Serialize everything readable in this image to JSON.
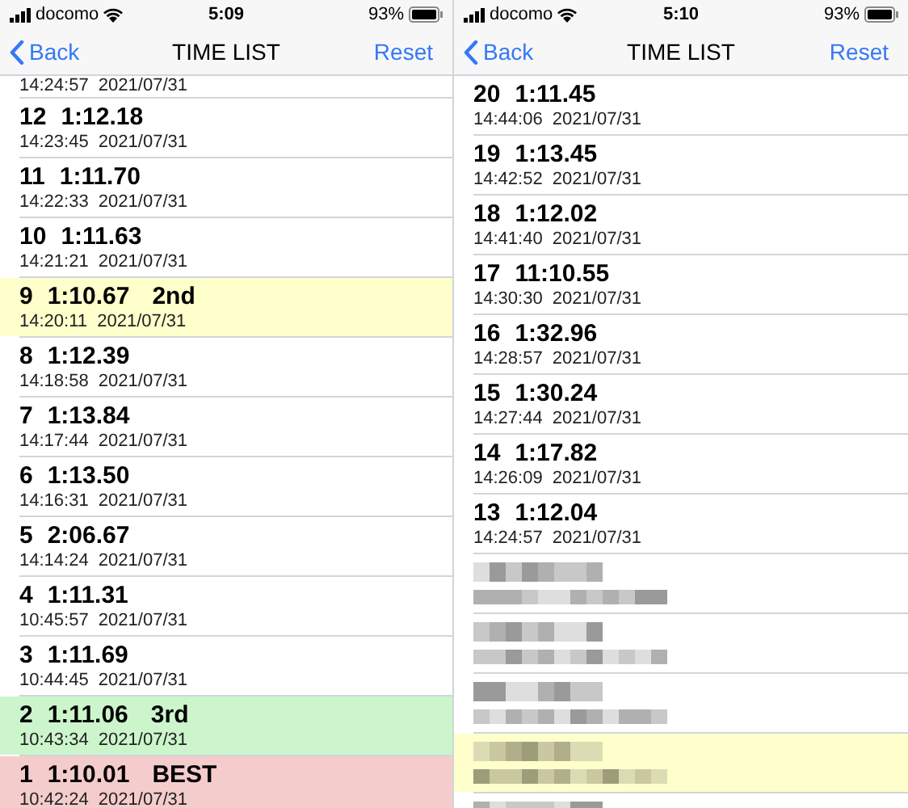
{
  "screens": [
    {
      "status_bar": {
        "carrier": "docomo",
        "time": "5:09",
        "battery": "93%"
      },
      "nav": {
        "back": "Back",
        "title": "TIME LIST",
        "action": "Reset"
      },
      "rows": [
        {
          "kind": "partial",
          "stamp": "14:24:57  2021/07/31",
          "color": "#ffffff"
        },
        {
          "kind": "lap",
          "number": "12",
          "time": "1:12.18",
          "stamp": "14:23:45  2021/07/31",
          "color": "#ffffff"
        },
        {
          "kind": "lap",
          "number": "11",
          "time": "1:11.70",
          "stamp": "14:22:33  2021/07/31",
          "color": "#ffffff"
        },
        {
          "kind": "lap",
          "number": "10",
          "time": "1:11.63",
          "stamp": "14:21:21  2021/07/31",
          "color": "#ffffff"
        },
        {
          "kind": "lap",
          "number": "9",
          "time": "1:10.67",
          "rank": "2nd",
          "stamp": "14:20:11  2021/07/31",
          "color": "#ffffcc"
        },
        {
          "kind": "lap",
          "number": "8",
          "time": "1:12.39",
          "stamp": "14:18:58  2021/07/31",
          "color": "#ffffff"
        },
        {
          "kind": "lap",
          "number": "7",
          "time": "1:13.84",
          "stamp": "14:17:44  2021/07/31",
          "color": "#ffffff"
        },
        {
          "kind": "lap",
          "number": "6",
          "time": "1:13.50",
          "stamp": "14:16:31  2021/07/31",
          "color": "#ffffff"
        },
        {
          "kind": "lap",
          "number": "5",
          "time": "2:06.67",
          "stamp": "14:14:24  2021/07/31",
          "color": "#ffffff"
        },
        {
          "kind": "lap",
          "number": "4",
          "time": "1:11.31",
          "stamp": "10:45:57  2021/07/31",
          "color": "#ffffff"
        },
        {
          "kind": "lap",
          "number": "3",
          "time": "1:11.69",
          "stamp": "10:44:45  2021/07/31",
          "color": "#ffffff"
        },
        {
          "kind": "lap",
          "number": "2",
          "time": "1:11.06",
          "rank": "3rd",
          "stamp": "10:43:34  2021/07/31",
          "color": "#ccf5cc"
        },
        {
          "kind": "lap",
          "number": "1",
          "time": "1:10.01",
          "rank": "BEST",
          "stamp": "10:42:24  2021/07/31",
          "color": "#f5cccc"
        }
      ]
    },
    {
      "status_bar": {
        "carrier": "docomo",
        "time": "5:10",
        "battery": "93%"
      },
      "nav": {
        "back": "Back",
        "title": "TIME LIST",
        "action": "Reset"
      },
      "rows": [
        {
          "kind": "lap",
          "number": "20",
          "time": "1:11.45",
          "stamp": "14:44:06  2021/07/31",
          "color": "#ffffff"
        },
        {
          "kind": "lap",
          "number": "19",
          "time": "1:13.45",
          "stamp": "14:42:52  2021/07/31",
          "color": "#ffffff"
        },
        {
          "kind": "lap",
          "number": "18",
          "time": "1:12.02",
          "stamp": "14:41:40  2021/07/31",
          "color": "#ffffff"
        },
        {
          "kind": "lap",
          "number": "17",
          "time": "11:10.55",
          "stamp": "14:30:30  2021/07/31",
          "color": "#ffffff"
        },
        {
          "kind": "lap",
          "number": "16",
          "time": "1:32.96",
          "stamp": "14:28:57  2021/07/31",
          "color": "#ffffff"
        },
        {
          "kind": "lap",
          "number": "15",
          "time": "1:30.24",
          "stamp": "14:27:44  2021/07/31",
          "color": "#ffffff"
        },
        {
          "kind": "lap",
          "number": "14",
          "time": "1:17.82",
          "stamp": "14:26:09  2021/07/31",
          "color": "#ffffff"
        },
        {
          "kind": "lap",
          "number": "13",
          "time": "1:12.04",
          "stamp": "14:24:57  2021/07/31",
          "color": "#ffffff"
        },
        {
          "kind": "blurred",
          "color": "#ffffff"
        },
        {
          "kind": "blurred",
          "color": "#ffffff"
        },
        {
          "kind": "blurred",
          "color": "#ffffff"
        },
        {
          "kind": "blurred",
          "color": "#ffffcc"
        },
        {
          "kind": "blurred",
          "color": "#ffffff"
        }
      ]
    }
  ]
}
